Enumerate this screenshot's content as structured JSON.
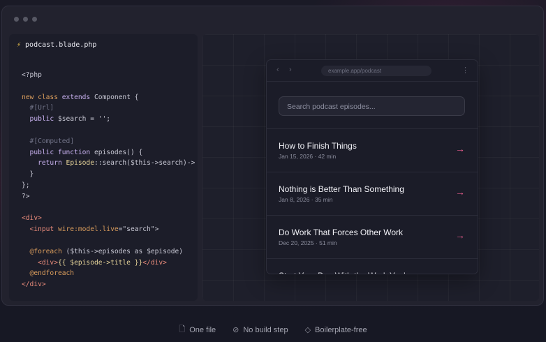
{
  "window": {
    "filename": "podcast.blade.php"
  },
  "code_lines": [
    [
      {
        "t": "<?php",
        "c": "t-plain"
      }
    ],
    [],
    [
      {
        "t": "new ",
        "c": "t-kw"
      },
      {
        "t": "class ",
        "c": "t-kw"
      },
      {
        "t": "extends ",
        "c": "t-kw2"
      },
      {
        "t": "Component {",
        "c": "t-plain"
      }
    ],
    [
      {
        "t": "  #[Url]",
        "c": "t-attr"
      }
    ],
    [
      {
        "t": "  public ",
        "c": "t-kw2"
      },
      {
        "t": "$search = '';",
        "c": "t-plain"
      }
    ],
    [],
    [
      {
        "t": "  #[Computed]",
        "c": "t-attr"
      }
    ],
    [
      {
        "t": "  public ",
        "c": "t-kw2"
      },
      {
        "t": "function ",
        "c": "t-kw2"
      },
      {
        "t": "episodes() {",
        "c": "t-plain"
      }
    ],
    [
      {
        "t": "    return ",
        "c": "t-kw2"
      },
      {
        "t": "Episode",
        "c": "t-fn"
      },
      {
        "t": "::search($this->search)->",
        "c": "t-plain"
      }
    ],
    [
      {
        "t": "  }",
        "c": "t-plain"
      }
    ],
    [
      {
        "t": "};",
        "c": "t-plain"
      }
    ],
    [
      {
        "t": "?>",
        "c": "t-plain"
      }
    ],
    [],
    [
      {
        "t": "<div>",
        "c": "t-tag"
      }
    ],
    [
      {
        "t": "  <input ",
        "c": "t-tag"
      },
      {
        "t": "wire:model.live",
        "c": "t-kw"
      },
      {
        "t": "=\"search\">",
        "c": "t-plain"
      }
    ],
    [],
    [
      {
        "t": "  @foreach ",
        "c": "t-at"
      },
      {
        "t": "($this->episodes as $episode)",
        "c": "t-plain"
      }
    ],
    [
      {
        "t": "    <div>",
        "c": "t-tag"
      },
      {
        "t": "{{ $episode->title }}",
        "c": "t-fn"
      },
      {
        "t": "</div>",
        "c": "t-tag"
      }
    ],
    [
      {
        "t": "  @endforeach",
        "c": "t-at"
      }
    ],
    [
      {
        "t": "</div>",
        "c": "t-tag"
      }
    ]
  ],
  "browser": {
    "url": "example.app/podcast",
    "back": "‹",
    "forward": "›",
    "menu": "⋮",
    "search_placeholder": "Search podcast episodes...",
    "episodes": [
      {
        "title": "How to Finish Things",
        "meta": "Jan 15, 2026 · 42 min"
      },
      {
        "title": "Nothing is Better Than Something",
        "meta": "Jan 8, 2026 · 35 min"
      },
      {
        "title": "Do Work That Forces Other Work",
        "meta": "Dec 20, 2025 · 51 min"
      },
      {
        "title": "Start Your Day With the Work You're",
        "meta": ""
      }
    ],
    "arrow": "→"
  },
  "features": [
    {
      "icon": "file-icon",
      "glyph": "🗋",
      "label": "One file"
    },
    {
      "icon": "no-build-icon",
      "glyph": "⊘",
      "label": "No build step"
    },
    {
      "icon": "eraser-icon",
      "glyph": "◇",
      "label": "Boilerplate-free"
    }
  ],
  "colors": {
    "accent": "#e95d8d",
    "bolt": "#f5c84b"
  }
}
